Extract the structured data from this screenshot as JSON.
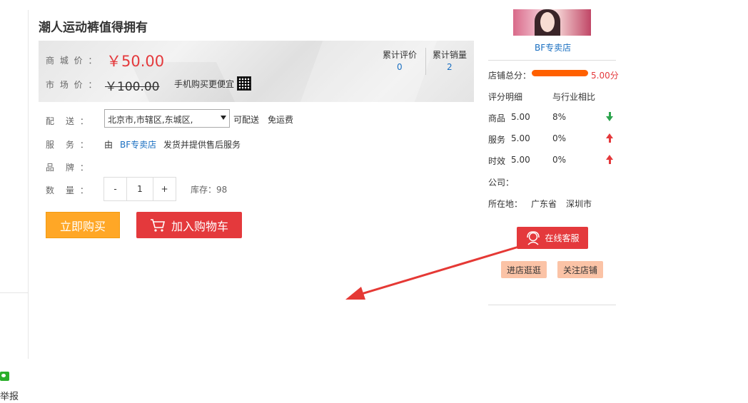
{
  "left_sidebar": {
    "report_label": "举报"
  },
  "product": {
    "title": "潮人运动裤值得拥有",
    "mall_price_label": "商 城 价 ：",
    "mall_price": "￥50.00",
    "market_price_label": "市 场 价 ：",
    "market_price": "￥100.00",
    "mobile_buy_text": "手机购买更便宜",
    "stats": [
      {
        "label": "累计评价",
        "value": "0"
      },
      {
        "label": "累计销量",
        "value": "2"
      }
    ],
    "delivery_label": "配　送 ：",
    "delivery_region": "北京市,市辖区,东城区,",
    "delivery_status": "可配送",
    "shipping_fee": "免运费",
    "service_label": "服　务 ：",
    "service_prefix": "由",
    "service_shop": "BF专卖店",
    "service_suffix": "发货并提供售后服务",
    "brand_label": "品　牌 ：",
    "quantity_label": "数　量 ：",
    "qty_minus": "-",
    "qty_value": "1",
    "qty_plus": "+",
    "stock_text": "库存：98",
    "buy_now_label": "立即购买",
    "add_cart_label": "加入购物车"
  },
  "shop": {
    "name": "BF专卖店",
    "total_score_label": "店铺总分：",
    "total_score_value": "5.00分",
    "total_score_fraction": 1.0,
    "detail_header": "评分明细",
    "compare_header": "与行业相比",
    "ratings": [
      {
        "name": "商品",
        "score": "5.00",
        "compare": "8%",
        "trend": "down"
      },
      {
        "name": "服务",
        "score": "5.00",
        "compare": "0%",
        "trend": "up"
      },
      {
        "name": "时效",
        "score": "5.00",
        "compare": "0%",
        "trend": "up"
      }
    ],
    "company_label": "公司：",
    "location_label": "所在地：",
    "province": "广东省",
    "city": "深圳市",
    "online_service_label": "在线客服",
    "visit_shop_label": "进店逛逛",
    "follow_shop_label": "关注店铺"
  },
  "colors": {
    "accent_red": "#e4393c",
    "orange": "#ffa726",
    "link_blue": "#1a6fc1"
  }
}
